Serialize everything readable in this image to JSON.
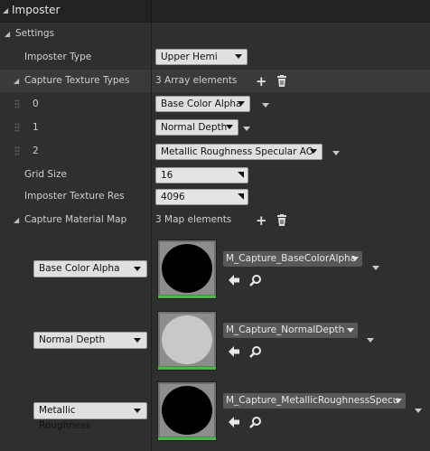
{
  "panel": {
    "title": "Imposter"
  },
  "settings": {
    "label": "Settings"
  },
  "imposter_type": {
    "label": "Imposter Type",
    "value": "Upper Hemi"
  },
  "capture_texture_types": {
    "label": "Capture Texture Types",
    "count_text": "3 Array elements",
    "items": [
      {
        "index": "0",
        "value": "Base Color Alpha"
      },
      {
        "index": "1",
        "value": "Normal Depth"
      },
      {
        "index": "2",
        "value": "Metallic Roughness Specular AO"
      }
    ]
  },
  "grid_size": {
    "label": "Grid Size",
    "value": "16"
  },
  "texture_res": {
    "label": "Imposter Texture Res",
    "value": "4096"
  },
  "capture_material_map": {
    "label": "Capture Material Map",
    "count_text": "3 Map elements",
    "entries": [
      {
        "key": "Base Color Alpha",
        "asset": "M_Capture_BaseColorAlpha",
        "ball_color": "#000000"
      },
      {
        "key": "Normal Depth",
        "asset": "M_Capture_NormalDepth",
        "ball_color": "#c8c8c8"
      },
      {
        "key": "Metallic Roughness",
        "asset": "M_Capture_MetallicRoughnessSpecu",
        "ball_color": "#000000"
      }
    ]
  },
  "icons": {
    "add": "plus-icon",
    "delete": "trash-icon",
    "browse_back": "arrow-left-icon",
    "find": "magnifier-icon"
  },
  "colors": {
    "accent_green": "#3fbf3f",
    "panel_bg": "#2f2f2f"
  }
}
